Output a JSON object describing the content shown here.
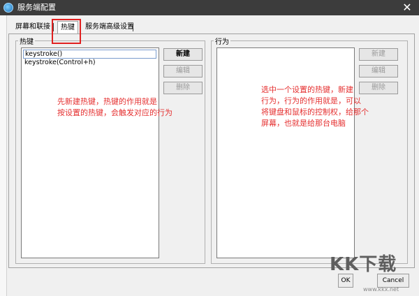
{
  "window": {
    "title": "服务端配置"
  },
  "tabs": [
    {
      "label": "屏幕和联接"
    },
    {
      "label": "热键"
    },
    {
      "label": "服务端高级设置"
    }
  ],
  "hotkey_group": {
    "title": "热键",
    "items": [
      "keystroke()",
      "keystroke(Control+h)"
    ],
    "buttons": {
      "new": "新建",
      "edit": "编辑",
      "delete": "删除"
    }
  },
  "action_group": {
    "title": "行为",
    "buttons": {
      "new": "新建",
      "edit": "编辑",
      "delete": "删除"
    }
  },
  "annotations": {
    "left": [
      "先新建热键，热键的作用就是",
      "按设置的热键，会触发对应的行为"
    ],
    "right": [
      "选中一个设置的热键，新建",
      "行为，行为的作用就是，可以",
      "将键盘和鼠标的控制权，给那个",
      "屏幕，也就是给那台电脑"
    ]
  },
  "dialog_buttons": {
    "ok": "OK",
    "cancel": "Cancel"
  },
  "watermark": {
    "text": "KK下载",
    "url": "www.kkx.net"
  },
  "colors": {
    "highlight": "#e02020",
    "annotation": "#e53030"
  }
}
